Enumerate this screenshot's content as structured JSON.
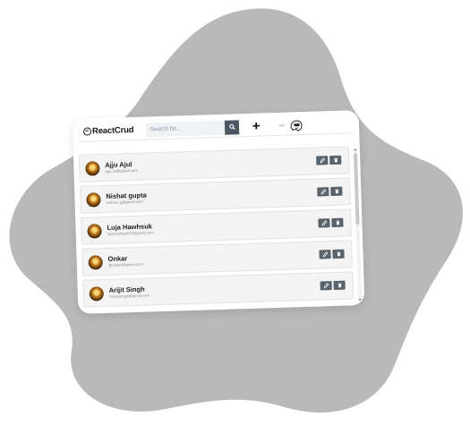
{
  "app": {
    "logo_text": "ReactCrud",
    "search": {
      "placeholder": "Search for..."
    },
    "add_label": "+",
    "user_label": "Hi!"
  },
  "contacts": [
    {
      "name": "Ajju Ajul",
      "email": "ajju.ak@gmail.com"
    },
    {
      "name": "Nishat gupta",
      "email": "nishant.g@gmail.com"
    },
    {
      "name": "Luja Hawhsuk",
      "email": "lujahswhsuk02@gmail.com"
    },
    {
      "name": "Onkar",
      "email": "@onkar@gmail.com"
    },
    {
      "name": "Arijit Singh",
      "email": "nahsdenge@gmail.com"
    }
  ],
  "icons": {
    "search": "search-icon",
    "edit": "edit-icon",
    "delete": "trash-icon",
    "avatar": "user-avatar"
  },
  "colors": {
    "blob": "#b9b9b9",
    "button": "#59636b",
    "search_button": "#4b5863",
    "row_background": "#f4f4f4"
  }
}
